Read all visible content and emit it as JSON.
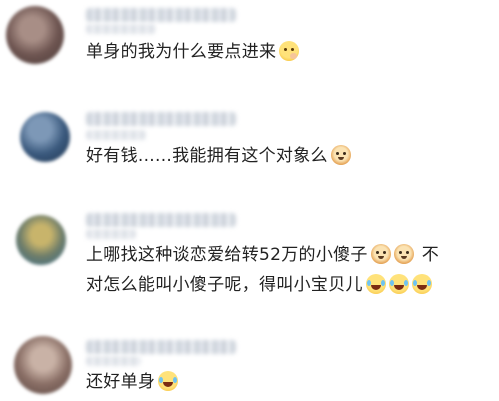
{
  "comments": [
    {
      "text": "单身的我为什么要点进来",
      "emojis": [
        "think-emoji"
      ]
    },
    {
      "text": "好有钱......我能拥有这个对象么",
      "emojis": [
        "doge-emoji"
      ]
    },
    {
      "line1": "上哪找这种谈恋爱给转52万的小傻子",
      "line1_emojis": [
        "doge-emoji",
        "doge-emoji"
      ],
      "line1_tail": "不",
      "line2": "对怎么能叫小傻子呢，得叫小宝贝儿",
      "line2_emojis": [
        "laugh-emoji",
        "laugh-emoji",
        "laugh-emoji"
      ]
    },
    {
      "text": "还好单身",
      "emojis": [
        "cry-laugh-emoji"
      ]
    }
  ],
  "colors": {
    "text": "#222222",
    "background": "#ffffff",
    "blur": "#cfd5dd"
  }
}
